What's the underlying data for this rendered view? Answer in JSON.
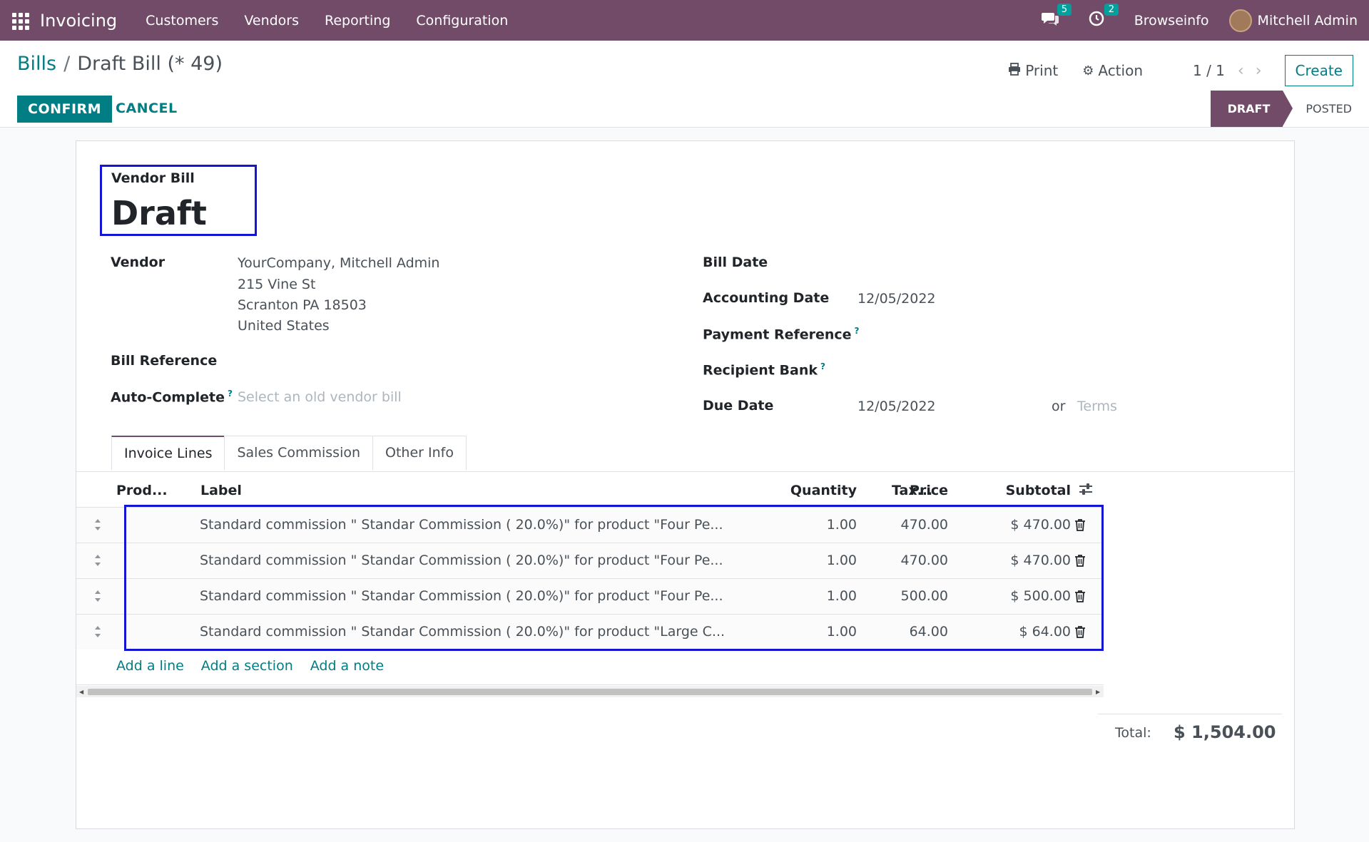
{
  "navbar": {
    "app_name": "Invoicing",
    "menu": [
      "Customers",
      "Vendors",
      "Reporting",
      "Configuration"
    ],
    "messages_count": "5",
    "activities_count": "2",
    "company": "Browseinfo",
    "user": "Mitchell Admin"
  },
  "control_panel": {
    "breadcrumb_parent": "Bills",
    "breadcrumb_separator": "/",
    "breadcrumb_current": "Draft Bill (* 49)",
    "print_label": "Print",
    "action_label": "Action",
    "pager": "1 / 1",
    "create_label": "Create",
    "confirm_label": "CONFIRM",
    "cancel_label": "CANCEL",
    "statuses": [
      "DRAFT",
      "POSTED"
    ],
    "active_status": "DRAFT"
  },
  "form": {
    "title_label": "Vendor Bill",
    "title_value": "Draft",
    "vendor_label": "Vendor",
    "vendor_lines": [
      "YourCompany, Mitchell Admin",
      "215 Vine St",
      "Scranton PA 18503",
      "United States"
    ],
    "bill_reference_label": "Bill Reference",
    "auto_complete_label": "Auto-Complete",
    "auto_complete_placeholder": "Select an old vendor bill",
    "bill_date_label": "Bill Date",
    "accounting_date_label": "Accounting Date",
    "accounting_date": "12/05/2022",
    "payment_reference_label": "Payment Reference",
    "recipient_bank_label": "Recipient Bank",
    "due_date_label": "Due Date",
    "due_date": "12/05/2022",
    "or_label": "or",
    "terms_placeholder": "Terms",
    "help_mark": "?"
  },
  "tabs": [
    "Invoice Lines",
    "Sales Commission",
    "Other Info"
  ],
  "active_tab": "Invoice Lines",
  "table": {
    "columns": {
      "product": "Prod...",
      "label": "Label",
      "quantity": "Quantity",
      "price": "Price",
      "tax": "Tax...",
      "subtotal": "Subtotal"
    },
    "rows": [
      {
        "label": "Standard commission \" Standar Commission ( 20.0%)\" for product \"Four Pe...",
        "quantity": "1.00",
        "price": "470.00",
        "subtotal": "$ 470.00"
      },
      {
        "label": "Standard commission \" Standar Commission ( 20.0%)\" for product \"Four Pe...",
        "quantity": "1.00",
        "price": "470.00",
        "subtotal": "$ 470.00"
      },
      {
        "label": "Standard commission \" Standar Commission ( 20.0%)\" for product \"Four Pe...",
        "quantity": "1.00",
        "price": "500.00",
        "subtotal": "$ 500.00"
      },
      {
        "label": "Standard commission \" Standar Commission ( 20.0%)\" for product \"Large C...",
        "quantity": "1.00",
        "price": "64.00",
        "subtotal": "$ 64.00"
      }
    ],
    "add_line": "Add a line",
    "add_section": "Add a section",
    "add_note": "Add a note"
  },
  "totals": {
    "label": "Total:",
    "value": "$ 1,504.00"
  },
  "colors": {
    "brand": "#714b67",
    "accent": "#017e84",
    "highlight_box": "#1414d4"
  }
}
